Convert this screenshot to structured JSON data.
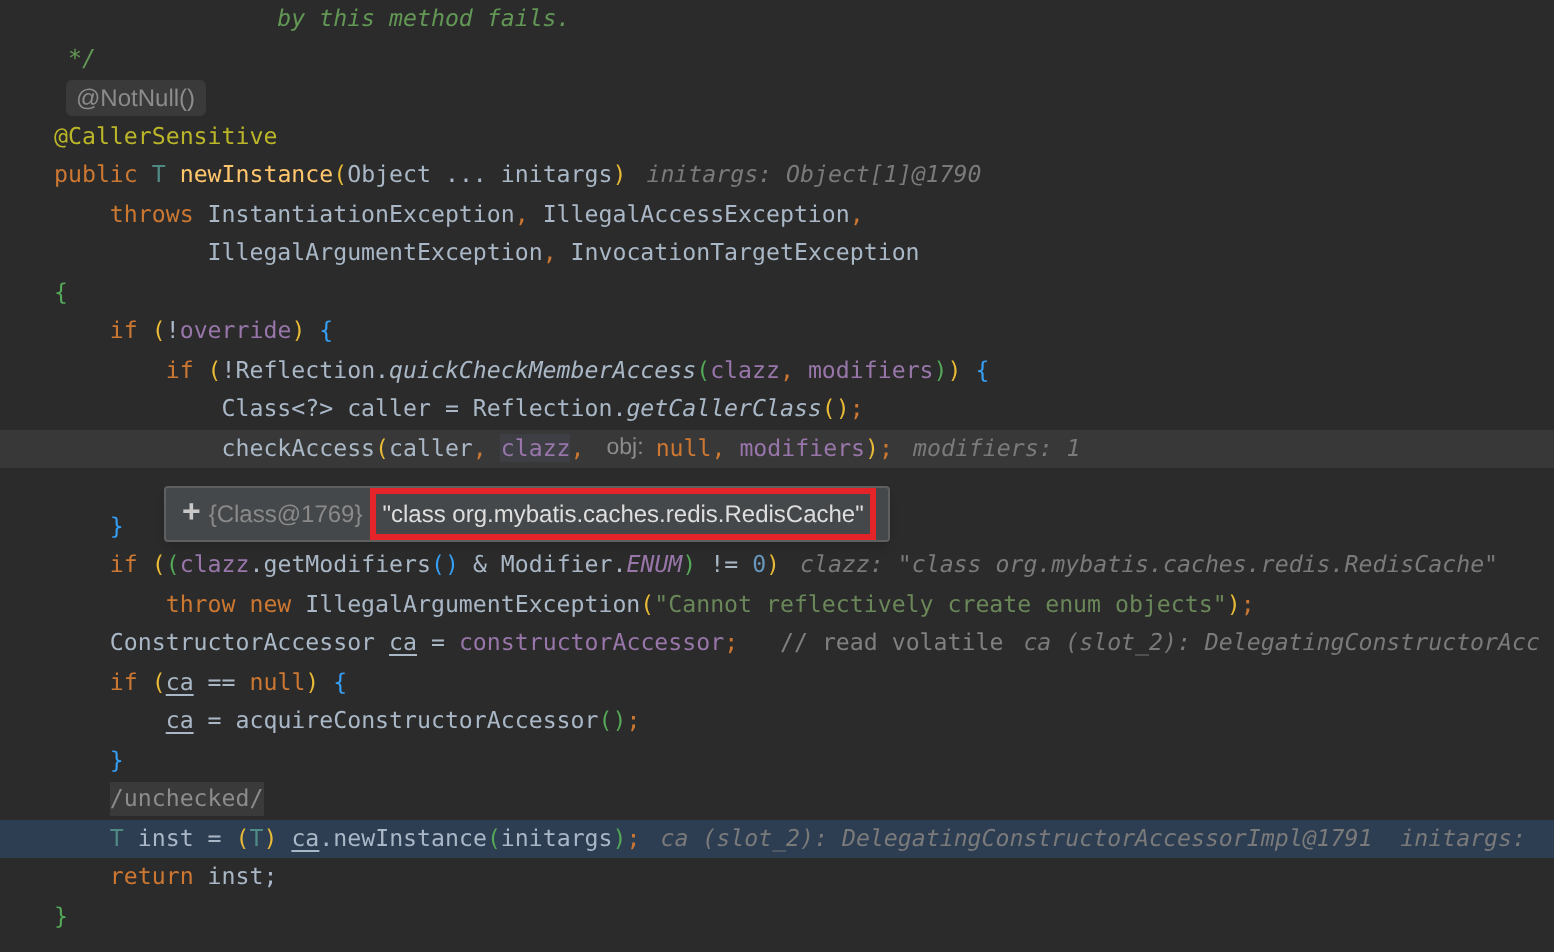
{
  "editor": {
    "lines": [
      {
        "caret": false,
        "execution": false,
        "tokens": [
          {
            "kind": "doc",
            "text": "                by this method fails."
          }
        ]
      },
      {
        "caret": false,
        "execution": false,
        "tokens": [
          {
            "kind": "doc",
            "text": " */"
          }
        ]
      },
      {
        "caret": false,
        "execution": false,
        "tokens": [
          {
            "kind": "pill",
            "text": "@NotNull()"
          }
        ]
      },
      {
        "caret": false,
        "execution": false,
        "tokens": [
          {
            "kind": "annot",
            "text": "@CallerSensitive"
          }
        ]
      },
      {
        "caret": false,
        "execution": false,
        "tokens": [
          {
            "kind": "kw",
            "text": "public "
          },
          {
            "kind": "type",
            "text": "T "
          },
          {
            "kind": "method",
            "text": "newInstance"
          },
          {
            "kind": "p1",
            "text": "("
          },
          {
            "kind": "text",
            "text": "Object ... initargs"
          },
          {
            "kind": "p1",
            "text": ")"
          },
          {
            "kind": "hint",
            "text": "initargs: Object[1]@1790"
          }
        ]
      },
      {
        "caret": false,
        "execution": false,
        "tokens": [
          {
            "kind": "kw",
            "text": "    throws "
          },
          {
            "kind": "text",
            "text": "InstantiationException"
          },
          {
            "kind": "punct",
            "text": ", "
          },
          {
            "kind": "text",
            "text": "IllegalAccessException"
          },
          {
            "kind": "punct",
            "text": ","
          }
        ]
      },
      {
        "caret": false,
        "execution": false,
        "tokens": [
          {
            "kind": "text",
            "text": "           IllegalArgumentException"
          },
          {
            "kind": "punct",
            "text": ", "
          },
          {
            "kind": "text",
            "text": "InvocationTargetException"
          }
        ]
      },
      {
        "caret": false,
        "execution": false,
        "tokens": [
          {
            "kind": "p2",
            "text": "{"
          }
        ]
      },
      {
        "caret": false,
        "execution": false,
        "tokens": [
          {
            "kind": "kw",
            "text": "    if "
          },
          {
            "kind": "p1",
            "text": "("
          },
          {
            "kind": "text",
            "text": "!"
          },
          {
            "kind": "field",
            "text": "override"
          },
          {
            "kind": "p1",
            "text": ")"
          },
          {
            "kind": "p3",
            "text": " {"
          }
        ]
      },
      {
        "caret": false,
        "execution": false,
        "tokens": [
          {
            "kind": "kw",
            "text": "        if "
          },
          {
            "kind": "p1",
            "text": "("
          },
          {
            "kind": "text",
            "text": "!Reflection."
          },
          {
            "kind": "italic",
            "text": "quickCheckMemberAccess"
          },
          {
            "kind": "p2",
            "text": "("
          },
          {
            "kind": "field",
            "text": "clazz"
          },
          {
            "kind": "punct",
            "text": ", "
          },
          {
            "kind": "field",
            "text": "modifiers"
          },
          {
            "kind": "p2",
            "text": ")"
          },
          {
            "kind": "p1",
            "text": ")"
          },
          {
            "kind": "p3",
            "text": " {"
          }
        ]
      },
      {
        "caret": false,
        "execution": false,
        "tokens": [
          {
            "kind": "text",
            "text": "            Class<?> caller = Reflection."
          },
          {
            "kind": "italic",
            "text": "getCallerClass"
          },
          {
            "kind": "p1",
            "text": "()"
          },
          {
            "kind": "punct",
            "text": ";"
          }
        ]
      },
      {
        "caret": true,
        "execution": false,
        "tokens": [
          {
            "kind": "text",
            "text": "            checkAccess"
          },
          {
            "kind": "p1",
            "text": "("
          },
          {
            "kind": "text",
            "text": "caller"
          },
          {
            "kind": "punct",
            "text": ", "
          },
          {
            "kind": "hover",
            "text": "clazz"
          },
          {
            "kind": "punct",
            "text": ", "
          },
          {
            "kind": "param",
            "text": "obj:"
          },
          {
            "kind": "kw",
            "text": "null"
          },
          {
            "kind": "punct",
            "text": ", "
          },
          {
            "kind": "field",
            "text": "modifiers"
          },
          {
            "kind": "p1",
            "text": ")"
          },
          {
            "kind": "punct",
            "text": ";"
          },
          {
            "kind": "hint",
            "text": "modifiers: 1"
          }
        ]
      },
      {
        "caret": false,
        "execution": false
      },
      {
        "caret": false,
        "execution": false,
        "tokens": [
          {
            "kind": "p3",
            "text": "    }"
          }
        ]
      },
      {
        "caret": false,
        "execution": false,
        "tokens": [
          {
            "kind": "kw",
            "text": "    if "
          },
          {
            "kind": "p1",
            "text": "("
          },
          {
            "kind": "p2",
            "text": "("
          },
          {
            "kind": "field",
            "text": "clazz"
          },
          {
            "kind": "text",
            "text": ".getModifiers"
          },
          {
            "kind": "p3",
            "text": "()"
          },
          {
            "kind": "text",
            "text": " & Modifier."
          },
          {
            "kind": "const",
            "text": "ENUM"
          },
          {
            "kind": "p2",
            "text": ")"
          },
          {
            "kind": "text",
            "text": " != "
          },
          {
            "kind": "num",
            "text": "0"
          },
          {
            "kind": "p1",
            "text": ")"
          },
          {
            "kind": "hint",
            "text": "clazz: \"class org.mybatis.caches.redis.RedisCache\""
          }
        ]
      },
      {
        "caret": false,
        "execution": false,
        "tokens": [
          {
            "kind": "kw",
            "text": "        throw new "
          },
          {
            "kind": "text",
            "text": "IllegalArgumentException"
          },
          {
            "kind": "p1",
            "text": "("
          },
          {
            "kind": "str",
            "text": "\"Cannot reflectively create enum objects\""
          },
          {
            "kind": "p1",
            "text": ")"
          },
          {
            "kind": "punct",
            "text": ";"
          }
        ]
      },
      {
        "caret": false,
        "execution": false,
        "tokens": [
          {
            "kind": "text",
            "text": "    ConstructorAccessor "
          },
          {
            "kind": "var",
            "text": "ca"
          },
          {
            "kind": "text",
            "text": " = "
          },
          {
            "kind": "field",
            "text": "constructorAccessor"
          },
          {
            "kind": "punct",
            "text": ";"
          },
          {
            "kind": "comment",
            "text": "   // read volatile"
          },
          {
            "kind": "hint",
            "text": "ca (slot_2): DelegatingConstructorAcc"
          }
        ]
      },
      {
        "caret": false,
        "execution": false,
        "tokens": [
          {
            "kind": "kw",
            "text": "    if "
          },
          {
            "kind": "p1",
            "text": "("
          },
          {
            "kind": "var",
            "text": "ca"
          },
          {
            "kind": "text",
            "text": " == "
          },
          {
            "kind": "kw",
            "text": "null"
          },
          {
            "kind": "p1",
            "text": ")"
          },
          {
            "kind": "p3",
            "text": " {"
          }
        ]
      },
      {
        "caret": false,
        "execution": false,
        "tokens": [
          {
            "kind": "var",
            "text": "        ca"
          },
          {
            "kind": "text",
            "text": " = acquireConstructorAccessor"
          },
          {
            "kind": "p2",
            "text": "()"
          },
          {
            "kind": "punct",
            "text": ";"
          }
        ]
      },
      {
        "caret": false,
        "execution": false,
        "tokens": [
          {
            "kind": "p3",
            "text": "    }"
          }
        ]
      },
      {
        "caret": false,
        "execution": false,
        "tokens": [
          {
            "kind": "fold",
            "text": "    /unchecked/"
          }
        ]
      },
      {
        "caret": false,
        "execution": true,
        "tokens": [
          {
            "kind": "type",
            "text": "    T "
          },
          {
            "kind": "text",
            "text": "inst = "
          },
          {
            "kind": "p1",
            "text": "("
          },
          {
            "kind": "type",
            "text": "T"
          },
          {
            "kind": "p1",
            "text": ")"
          },
          {
            "kind": "var",
            "text": " ca"
          },
          {
            "kind": "text",
            "text": ".newInstance"
          },
          {
            "kind": "p2",
            "text": "("
          },
          {
            "kind": "text",
            "text": "initargs"
          },
          {
            "kind": "p2",
            "text": ")"
          },
          {
            "kind": "punct",
            "text": ";"
          },
          {
            "kind": "hint",
            "text": "ca (slot_2): DelegatingConstructorAccessorImpl@1791  initargs:"
          }
        ]
      },
      {
        "caret": false,
        "execution": false,
        "tokens": [
          {
            "kind": "kw",
            "text": "    return "
          },
          {
            "kind": "text",
            "text": "inst;"
          }
        ]
      },
      {
        "caret": false,
        "execution": false,
        "tokens": [
          {
            "kind": "p2",
            "text": "}"
          }
        ]
      }
    ]
  },
  "tooltip": {
    "expand": "+",
    "label": "{Class@1769}",
    "value": "\"class org.mybatis.caches.redis.RedisCache\"",
    "marked": true
  }
}
